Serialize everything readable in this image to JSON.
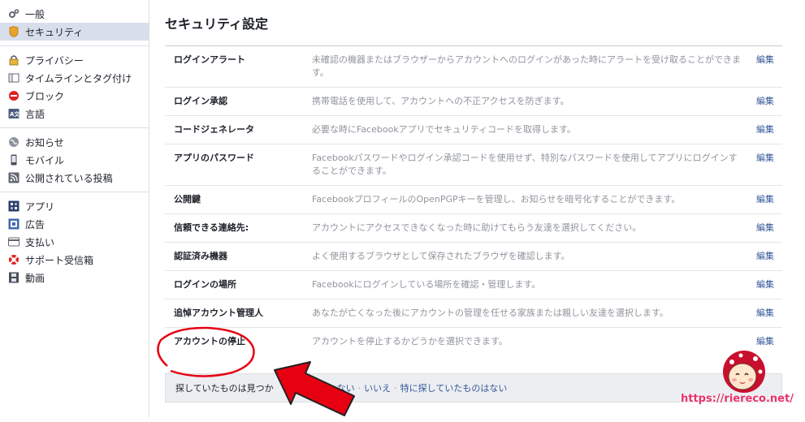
{
  "sidebar": {
    "groups": [
      {
        "items": [
          {
            "label": "一般",
            "icon": "gears-icon"
          },
          {
            "label": "セキュリティ",
            "icon": "shield-icon",
            "active": true
          }
        ]
      },
      {
        "items": [
          {
            "label": "プライバシー",
            "icon": "lock-icon"
          },
          {
            "label": "タイムラインとタグ付け",
            "icon": "timeline-icon"
          },
          {
            "label": "ブロック",
            "icon": "block-icon"
          },
          {
            "label": "言語",
            "icon": "language-icon"
          }
        ]
      },
      {
        "items": [
          {
            "label": "お知らせ",
            "icon": "globe-icon"
          },
          {
            "label": "モバイル",
            "icon": "mobile-icon"
          },
          {
            "label": "公開されている投稿",
            "icon": "rss-icon"
          }
        ]
      },
      {
        "items": [
          {
            "label": "アプリ",
            "icon": "apps-icon"
          },
          {
            "label": "広告",
            "icon": "ads-icon"
          },
          {
            "label": "支払い",
            "icon": "card-icon"
          },
          {
            "label": "サポート受信箱",
            "icon": "lifebuoy-icon"
          },
          {
            "label": "動画",
            "icon": "film-icon"
          }
        ]
      }
    ]
  },
  "main": {
    "title": "セキュリティ設定",
    "edit_label": "編集",
    "rows": [
      {
        "label": "ログインアラート",
        "desc": "未確認の機器またはブラウザーからアカウントへのログインがあった時にアラートを受け取ることができます。"
      },
      {
        "label": "ログイン承認",
        "desc": "携帯電話を使用して、アカウントへの不正アクセスを防ぎます。"
      },
      {
        "label": "コードジェネレータ",
        "desc": "必要な時にFacebookアプリでセキュリティコードを取得します。"
      },
      {
        "label": "アプリのパスワード",
        "desc": "Facebookパスワードやログイン承認コードを使用せず、特別なパスワードを使用してアプリにログインすることができます。"
      },
      {
        "label": "公開鍵",
        "desc": "FacebookプロフィールのOpenPGPキーを管理し、お知らせを暗号化することができます。"
      },
      {
        "label": "信頼できる連絡先:",
        "desc": "アカウントにアクセスできなくなった時に助けてもらう友達を選択してください。"
      },
      {
        "label": "認証済み機器",
        "desc": "よく使用するブラウザとして保存されたブラウザを確認します。"
      },
      {
        "label": "ログインの場所",
        "desc": "Facebookにログインしている場所を確認・管理します。"
      },
      {
        "label": "追悼アカウント管理人",
        "desc": "あなたが亡くなった後にアカウントの管理を任せる家族または親しい友達を選択します。"
      },
      {
        "label": "アカウントの停止",
        "desc": "アカウントを停止するかどうかを選択できます。"
      }
    ],
    "footer": {
      "question": "探していたものは見つか",
      "link_no": "ない",
      "link_no2": "いいえ",
      "link_notfound": "特に探していたものはない"
    }
  },
  "watermark": "https://riereco.net/",
  "colors": {
    "accent": "#365899",
    "highlight": "#d8dfea",
    "annotation": "#e60012"
  }
}
